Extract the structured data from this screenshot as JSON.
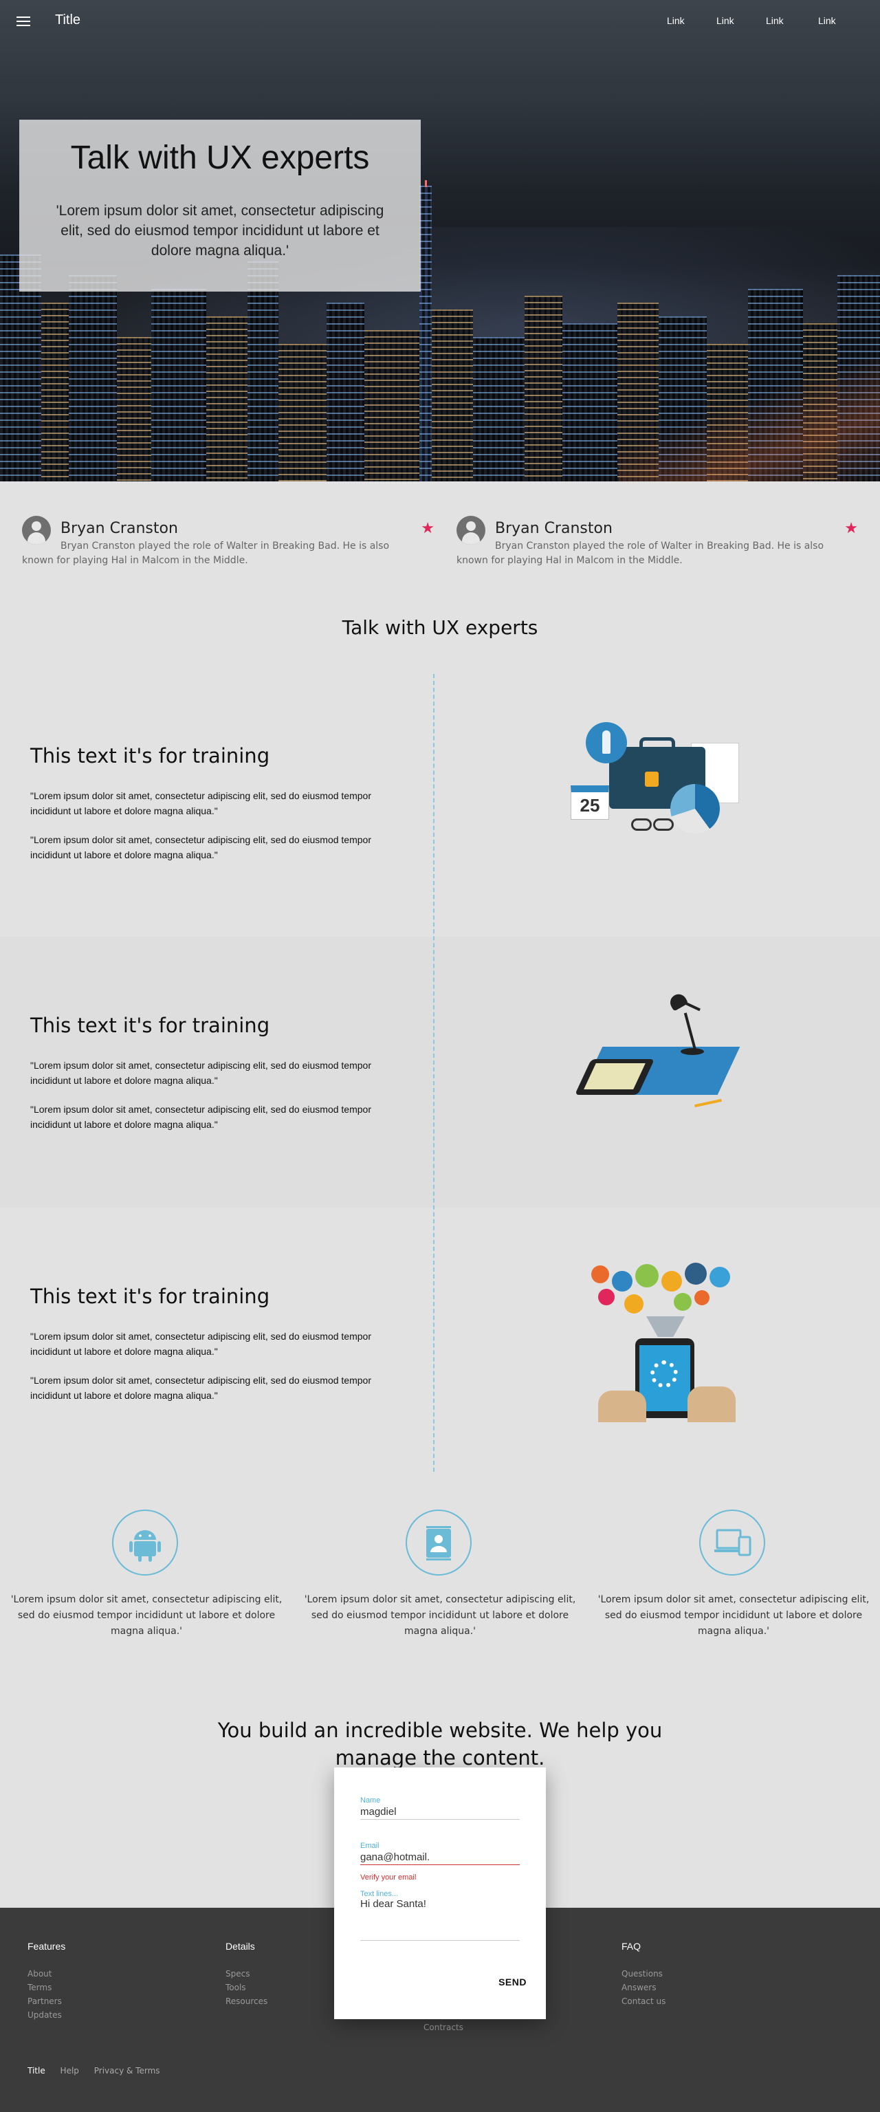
{
  "header": {
    "title": "Title",
    "links": [
      "Link",
      "Link",
      "Link",
      "Link"
    ]
  },
  "hero": {
    "title": "Talk with UX experts",
    "text": "'Lorem ipsum dolor sit amet, consectetur adipiscing elit, sed do eiusmod tempor incididunt ut labore et dolore magna aliqua.'"
  },
  "testimonials": [
    {
      "name": "Bryan Cranston",
      "text": "Bryan Cranston played the role of Walter in Breaking Bad. He is also known for playing Hal in Malcom in the Middle."
    },
    {
      "name": "Bryan Cranston",
      "text": "Bryan Cranston played the role of Walter in Breaking Bad. He is also known for playing Hal in Malcom in the Middle."
    }
  ],
  "section": {
    "heading": "Talk with UX experts",
    "rows": [
      {
        "title": "This text it's for training",
        "p1": "\"Lorem ipsum dolor sit amet, consectetur adipiscing elit, sed do eiusmod tempor incididunt ut labore et dolore magna aliqua.\"",
        "p2": "\"Lorem ipsum dolor sit amet, consectetur adipiscing elit, sed do eiusmod tempor incididunt ut labore et dolore magna aliqua.\""
      },
      {
        "title": "This text it's for training",
        "p1": "\"Lorem ipsum dolor sit amet, consectetur adipiscing elit, sed do eiusmod tempor incididunt ut labore et dolore magna aliqua.\"",
        "p2": "\"Lorem ipsum dolor sit amet, consectetur adipiscing elit, sed do eiusmod tempor incididunt ut labore et dolore magna aliqua.\""
      },
      {
        "title": "This text it's for training",
        "p1": "\"Lorem ipsum dolor sit amet, consectetur adipiscing elit, sed do eiusmod tempor incididunt ut labore et dolore magna aliqua.\"",
        "p2": "\"Lorem ipsum dolor sit amet, consectetur adipiscing elit, sed do eiusmod tempor incididunt ut labore et dolore magna aliqua.\""
      }
    ],
    "calendar_number": "25"
  },
  "features": [
    {
      "icon": "android-icon",
      "text": "'Lorem ipsum dolor sit amet, consectetur adipiscing elit, sed do eiusmod tempor incididunt ut labore et dolore magna aliqua.'"
    },
    {
      "icon": "contact-card-icon",
      "text": "'Lorem ipsum dolor sit amet, consectetur adipiscing elit, sed do eiusmod tempor incididunt ut labore et dolore magna aliqua.'"
    },
    {
      "icon": "devices-icon",
      "text": "'Lorem ipsum dolor sit amet, consectetur adipiscing elit, sed do eiusmod tempor incididunt ut labore et dolore magna aliqua.'"
    }
  ],
  "cta": "You build an incredible website. We help you manage the content.",
  "form": {
    "name_label": "Name",
    "name_value": "magdiel",
    "email_label": "Email",
    "email_value": "gana@hotmail.",
    "email_error": "Verify your email",
    "text_label": "Text lines...",
    "text_value": "Hi dear Santa!",
    "send": "SEND"
  },
  "footer": {
    "columns": [
      {
        "title": "Features",
        "items": [
          "About",
          "Terms",
          "Partners",
          "Updates"
        ]
      },
      {
        "title": "Details",
        "items": [
          "Specs",
          "Tools",
          "Resources"
        ]
      },
      {
        "title": "",
        "items": [
          "Contracts"
        ]
      },
      {
        "title": "FAQ",
        "items": [
          "Questions",
          "Answers",
          "Contact us"
        ]
      }
    ],
    "bottom": [
      "Title",
      "Help",
      "Privacy & Terms"
    ]
  },
  "colors": {
    "accent": "#4fb3d6",
    "star": "#e0265a",
    "error": "#d32f2f",
    "footer_bg": "#3b3b3b"
  }
}
